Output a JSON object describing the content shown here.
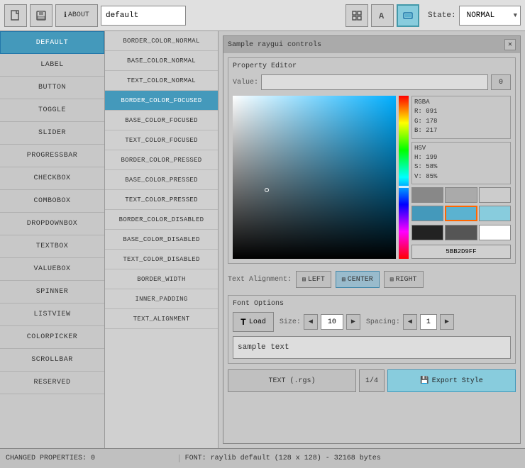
{
  "toolbar": {
    "style_name": "default",
    "state_label": "State:",
    "state_value": "NORMAL",
    "new_icon": "📄",
    "save_icon": "💾",
    "about_label": "ABOUT"
  },
  "controls": {
    "items": [
      {
        "id": "DEFAULT",
        "label": "DEFAULT",
        "active": true
      },
      {
        "id": "LABEL",
        "label": "LABEL",
        "active": false
      },
      {
        "id": "BUTTON",
        "label": "BUTTON",
        "active": false
      },
      {
        "id": "TOGGLE",
        "label": "TOGGLE",
        "active": false
      },
      {
        "id": "SLIDER",
        "label": "SLIDER",
        "active": false
      },
      {
        "id": "PROGRESSBAR",
        "label": "PROGRESSBAR",
        "active": false
      },
      {
        "id": "CHECKBOX",
        "label": "CHECKBOX",
        "active": false
      },
      {
        "id": "COMBOBOX",
        "label": "COMBOBOX",
        "active": false
      },
      {
        "id": "DROPDOWNBOX",
        "label": "DROPDOWNBOX",
        "active": false
      },
      {
        "id": "TEXTBOX",
        "label": "TEXTBOX",
        "active": false
      },
      {
        "id": "VALUEBOX",
        "label": "VALUEBOX",
        "active": false
      },
      {
        "id": "SPINNER",
        "label": "SPINNER",
        "active": false
      },
      {
        "id": "LISTVIEW",
        "label": "LISTVIEW",
        "active": false
      },
      {
        "id": "COLORPICKER",
        "label": "COLORPICKER",
        "active": false
      },
      {
        "id": "SCROLLBAR",
        "label": "SCROLLBAR",
        "active": false
      },
      {
        "id": "RESERVED",
        "label": "RESERVED",
        "active": false
      }
    ]
  },
  "properties": {
    "items": [
      {
        "id": "BORDER_COLOR_NORMAL",
        "label": "BORDER_COLOR_NORMAL",
        "active": false
      },
      {
        "id": "BASE_COLOR_NORMAL",
        "label": "BASE_COLOR_NORMAL",
        "active": false
      },
      {
        "id": "TEXT_COLOR_NORMAL",
        "label": "TEXT_COLOR_NORMAL",
        "active": false
      },
      {
        "id": "BORDER_COLOR_FOCUSED",
        "label": "BORDER_COLOR_FOCUSED",
        "active": true
      },
      {
        "id": "BASE_COLOR_FOCUSED",
        "label": "BASE_COLOR_FOCUSED",
        "active": false
      },
      {
        "id": "TEXT_COLOR_FOCUSED",
        "label": "TEXT_COLOR_FOCUSED",
        "active": false
      },
      {
        "id": "BORDER_COLOR_PRESSED",
        "label": "BORDER_COLOR_PRESSED",
        "active": false
      },
      {
        "id": "BASE_COLOR_PRESSED",
        "label": "BASE_COLOR_PRESSED",
        "active": false
      },
      {
        "id": "TEXT_COLOR_PRESSED",
        "label": "TEXT_COLOR_PRESSED",
        "active": false
      },
      {
        "id": "BORDER_COLOR_DISABLED",
        "label": "BORDER_COLOR_DISABLED",
        "active": false
      },
      {
        "id": "BASE_COLOR_DISABLED",
        "label": "BASE_COLOR_DISABLED",
        "active": false
      },
      {
        "id": "TEXT_COLOR_DISABLED",
        "label": "TEXT_COLOR_DISABLED",
        "active": false
      },
      {
        "id": "BORDER_WIDTH",
        "label": "BORDER_WIDTH",
        "active": false
      },
      {
        "id": "INNER_PADDING",
        "label": "INNER_PADDING",
        "active": false
      },
      {
        "id": "TEXT_ALIGNMENT",
        "label": "TEXT_ALIGNMENT",
        "active": false
      }
    ]
  },
  "sample_window": {
    "title": "Sample raygui controls",
    "close_icon": "✕"
  },
  "property_editor": {
    "title": "Property Editor",
    "value_label": "Value:",
    "value_placeholder": "",
    "btn_label": "0"
  },
  "color_picker": {
    "sv_cursor_left": "21%",
    "sv_cursor_top": "58%",
    "hue_cursor_top": "55%",
    "rgba": {
      "title": "RGBA",
      "r": "R: 091",
      "g": "G: 178",
      "b": "B: 217",
      "a": ""
    },
    "hsv": {
      "title": "HSV",
      "h": "H: 199",
      "s": "S: 58%",
      "v": "V: 85%"
    },
    "swatches": [
      "#888888",
      "#aaaaaa",
      "#cccccc",
      "#4499bb",
      "#5bb2d0",
      "#88ccdd",
      "#222222",
      "#555555",
      "#ffffff"
    ],
    "hex_value": "5BB2D9FF"
  },
  "text_alignment": {
    "label": "Text Alignment:",
    "left": "LEFT",
    "center": "CENTER",
    "right": "RIGHT"
  },
  "font_options": {
    "title": "Font Options",
    "load_icon": "T",
    "load_label": "Load",
    "size_label": "Size:",
    "size_value": "10",
    "spacing_label": "Spacing:",
    "spacing_value": "1",
    "sample_text": "sample text"
  },
  "bottom_bar": {
    "text_rgs_label": "TEXT (.rgs)",
    "page_indicator": "1/4",
    "export_icon": "⬛",
    "export_label": "Export Style"
  },
  "status_bar": {
    "changed": "CHANGED PROPERTIES: 0",
    "font": "FONT: raylib default (128 x 128) - 32168 bytes"
  }
}
